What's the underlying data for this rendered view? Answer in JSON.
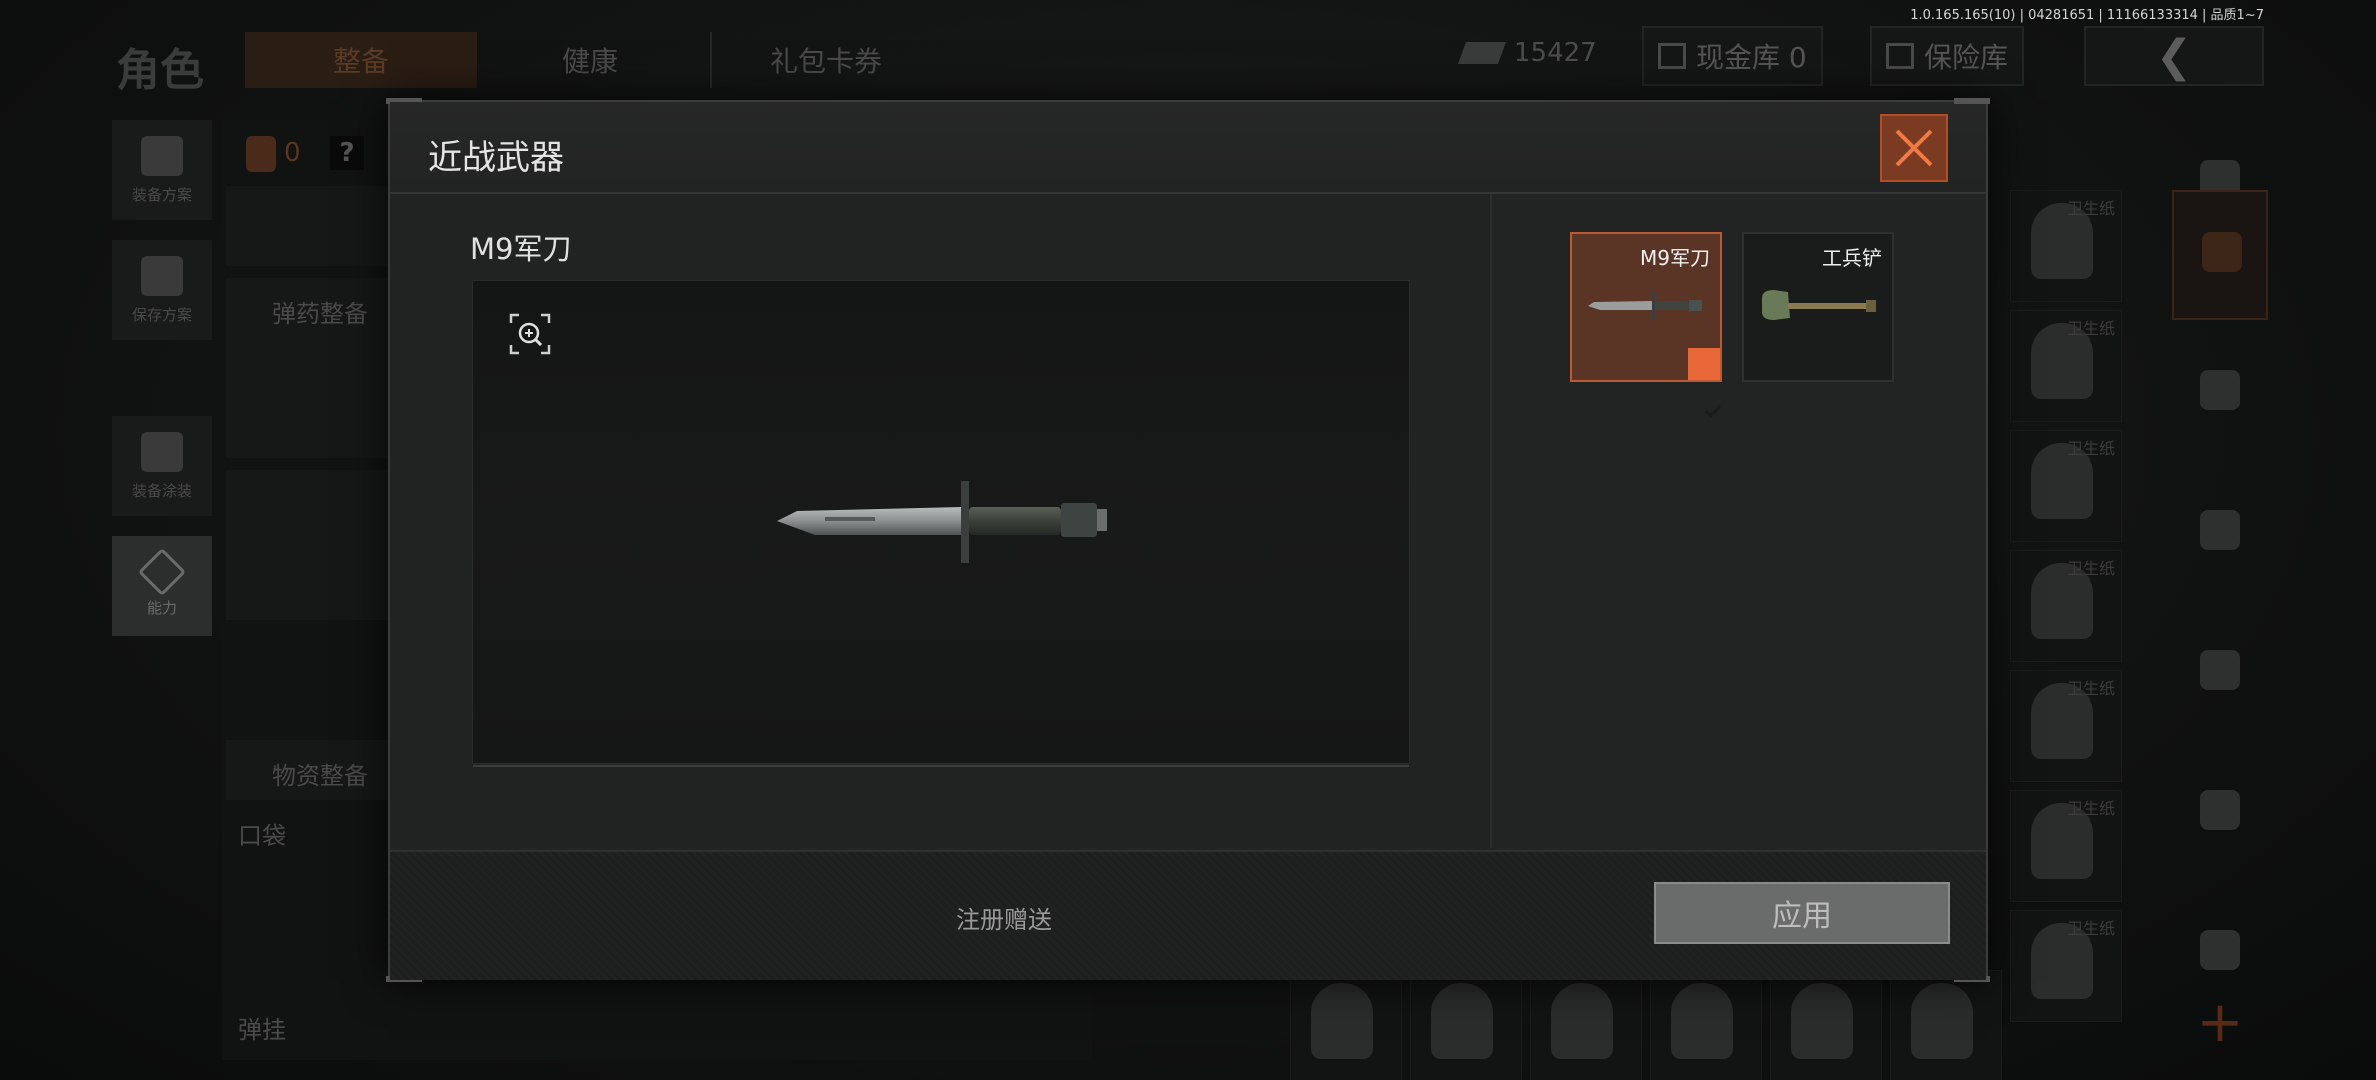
{
  "version_text": "1.0.165.165(10) | 04281651 | 11166133314 | 品质1~7",
  "background": {
    "title": "角色",
    "tabs": [
      "整备",
      "健康",
      "礼包卡券"
    ],
    "money": "15427",
    "cash_vault": "现金库 0",
    "insurance": "保险库",
    "left_buttons": [
      "装备方案",
      "保存方案",
      "装备涂装",
      "能力"
    ],
    "inventory_zero": "0",
    "help": "?",
    "sections": [
      "弹药整备",
      "物资整备",
      "口袋",
      "弹挂"
    ],
    "grid_item_label": "卫生纸",
    "plus": "+"
  },
  "modal": {
    "title": "近战武器",
    "selected_item_name": "M9军刀",
    "weapons": [
      {
        "name": "M9军刀",
        "selected": true
      },
      {
        "name": "工兵铲",
        "selected": false
      }
    ],
    "footer_note": "注册赠送",
    "apply_label": "应用"
  },
  "colors": {
    "accent": "#e8683a",
    "close_bg": "#7a3b22",
    "selected_card": "#5a3526"
  },
  "icons": [
    "zoom-in-icon",
    "close-icon",
    "check-icon",
    "knife-icon",
    "shovel-icon"
  ]
}
